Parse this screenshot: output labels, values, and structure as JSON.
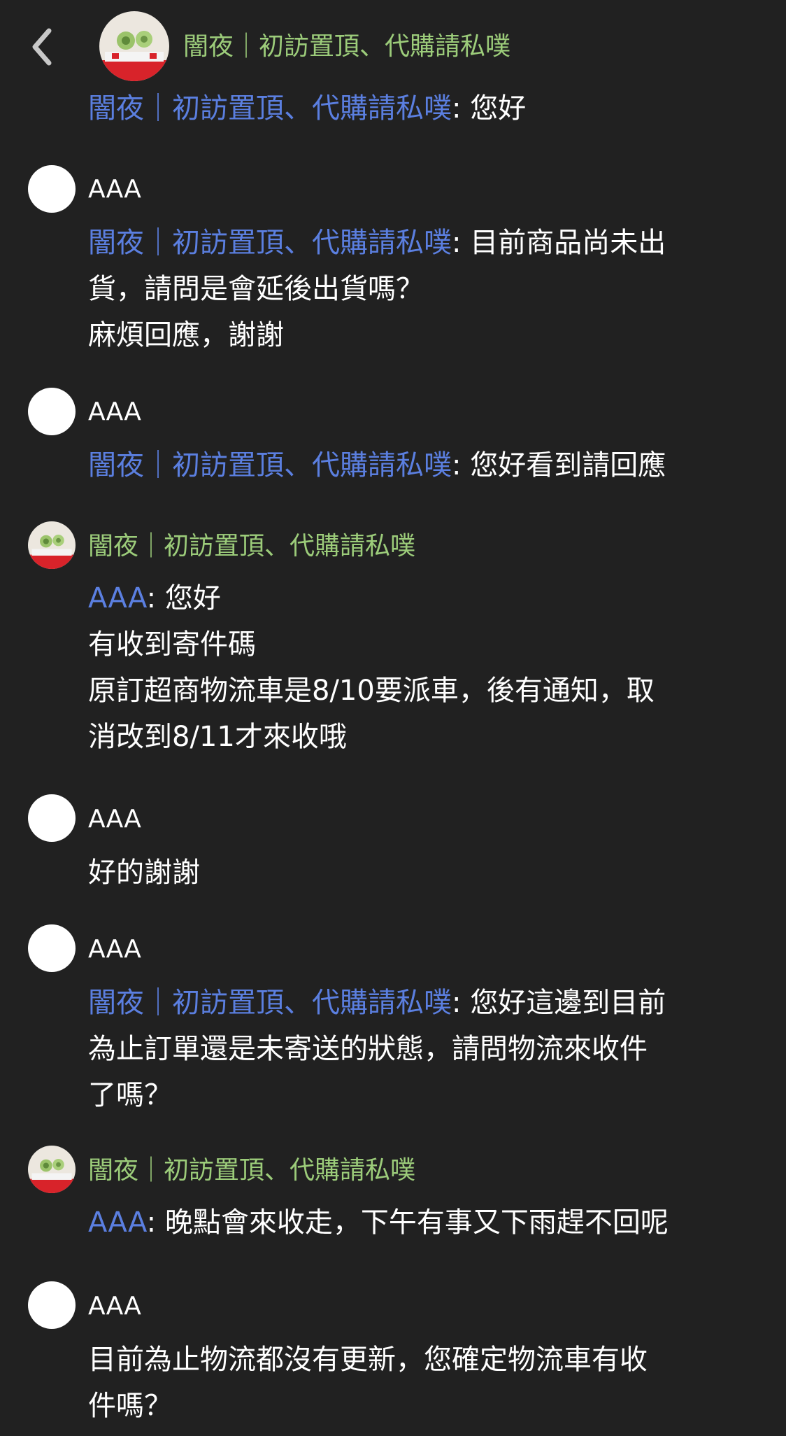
{
  "header": {
    "title": "闇夜｜初訪置頂、代購請私噗",
    "back_icon": "chevron-left-icon",
    "avatar_icon": "shop-avatar-image"
  },
  "first_message": {
    "mention": "闇夜｜初訪置頂、代購請私噗",
    "text": ": 您好"
  },
  "colors": {
    "background": "#212121",
    "mention": "#5b7fe0",
    "shop_name": "#9ccc7a",
    "text": "#ffffff"
  },
  "messages": [
    {
      "sender": "AAA",
      "lines": [
        {
          "mention": "闇夜｜初訪置頂、代購請私噗",
          "text": ": 目前商品尚未出"
        },
        {
          "text": "貨，請問是會延後出貨嗎？"
        },
        {
          "text": "麻煩回應，謝謝"
        }
      ]
    },
    {
      "sender": "AAA",
      "lines": [
        {
          "mention": "闇夜｜初訪置頂、代購請私噗",
          "text": ": 您好看到請回應"
        }
      ]
    },
    {
      "sender": "闇夜｜初訪置頂、代購請私噗",
      "lines": [
        {
          "mention": "AAA",
          "text": ": 您好"
        },
        {
          "text": "有收到寄件碼"
        },
        {
          "text": "原訂超商物流車是8/10要派車，後有通知，取"
        },
        {
          "text": "消改到8/11才來收哦"
        }
      ]
    },
    {
      "sender": "AAA",
      "lines": [
        {
          "text": "好的謝謝"
        }
      ]
    },
    {
      "sender": "AAA",
      "lines": [
        {
          "mention": "闇夜｜初訪置頂、代購請私噗",
          "text": ": 您好這邊到目前"
        },
        {
          "text": "為止訂單還是未寄送的狀態，請問物流來收件"
        },
        {
          "text": "了嗎？"
        }
      ]
    },
    {
      "sender": "闇夜｜初訪置頂、代購請私噗",
      "lines": [
        {
          "mention": "AAA",
          "text": ": 晚點會來收走，下午有事又下雨趕不回呢"
        }
      ]
    },
    {
      "sender": "AAA",
      "lines": [
        {
          "text": "目前為止物流都沒有更新，您確定物流車有收"
        },
        {
          "text": "件嗎？"
        }
      ]
    }
  ]
}
